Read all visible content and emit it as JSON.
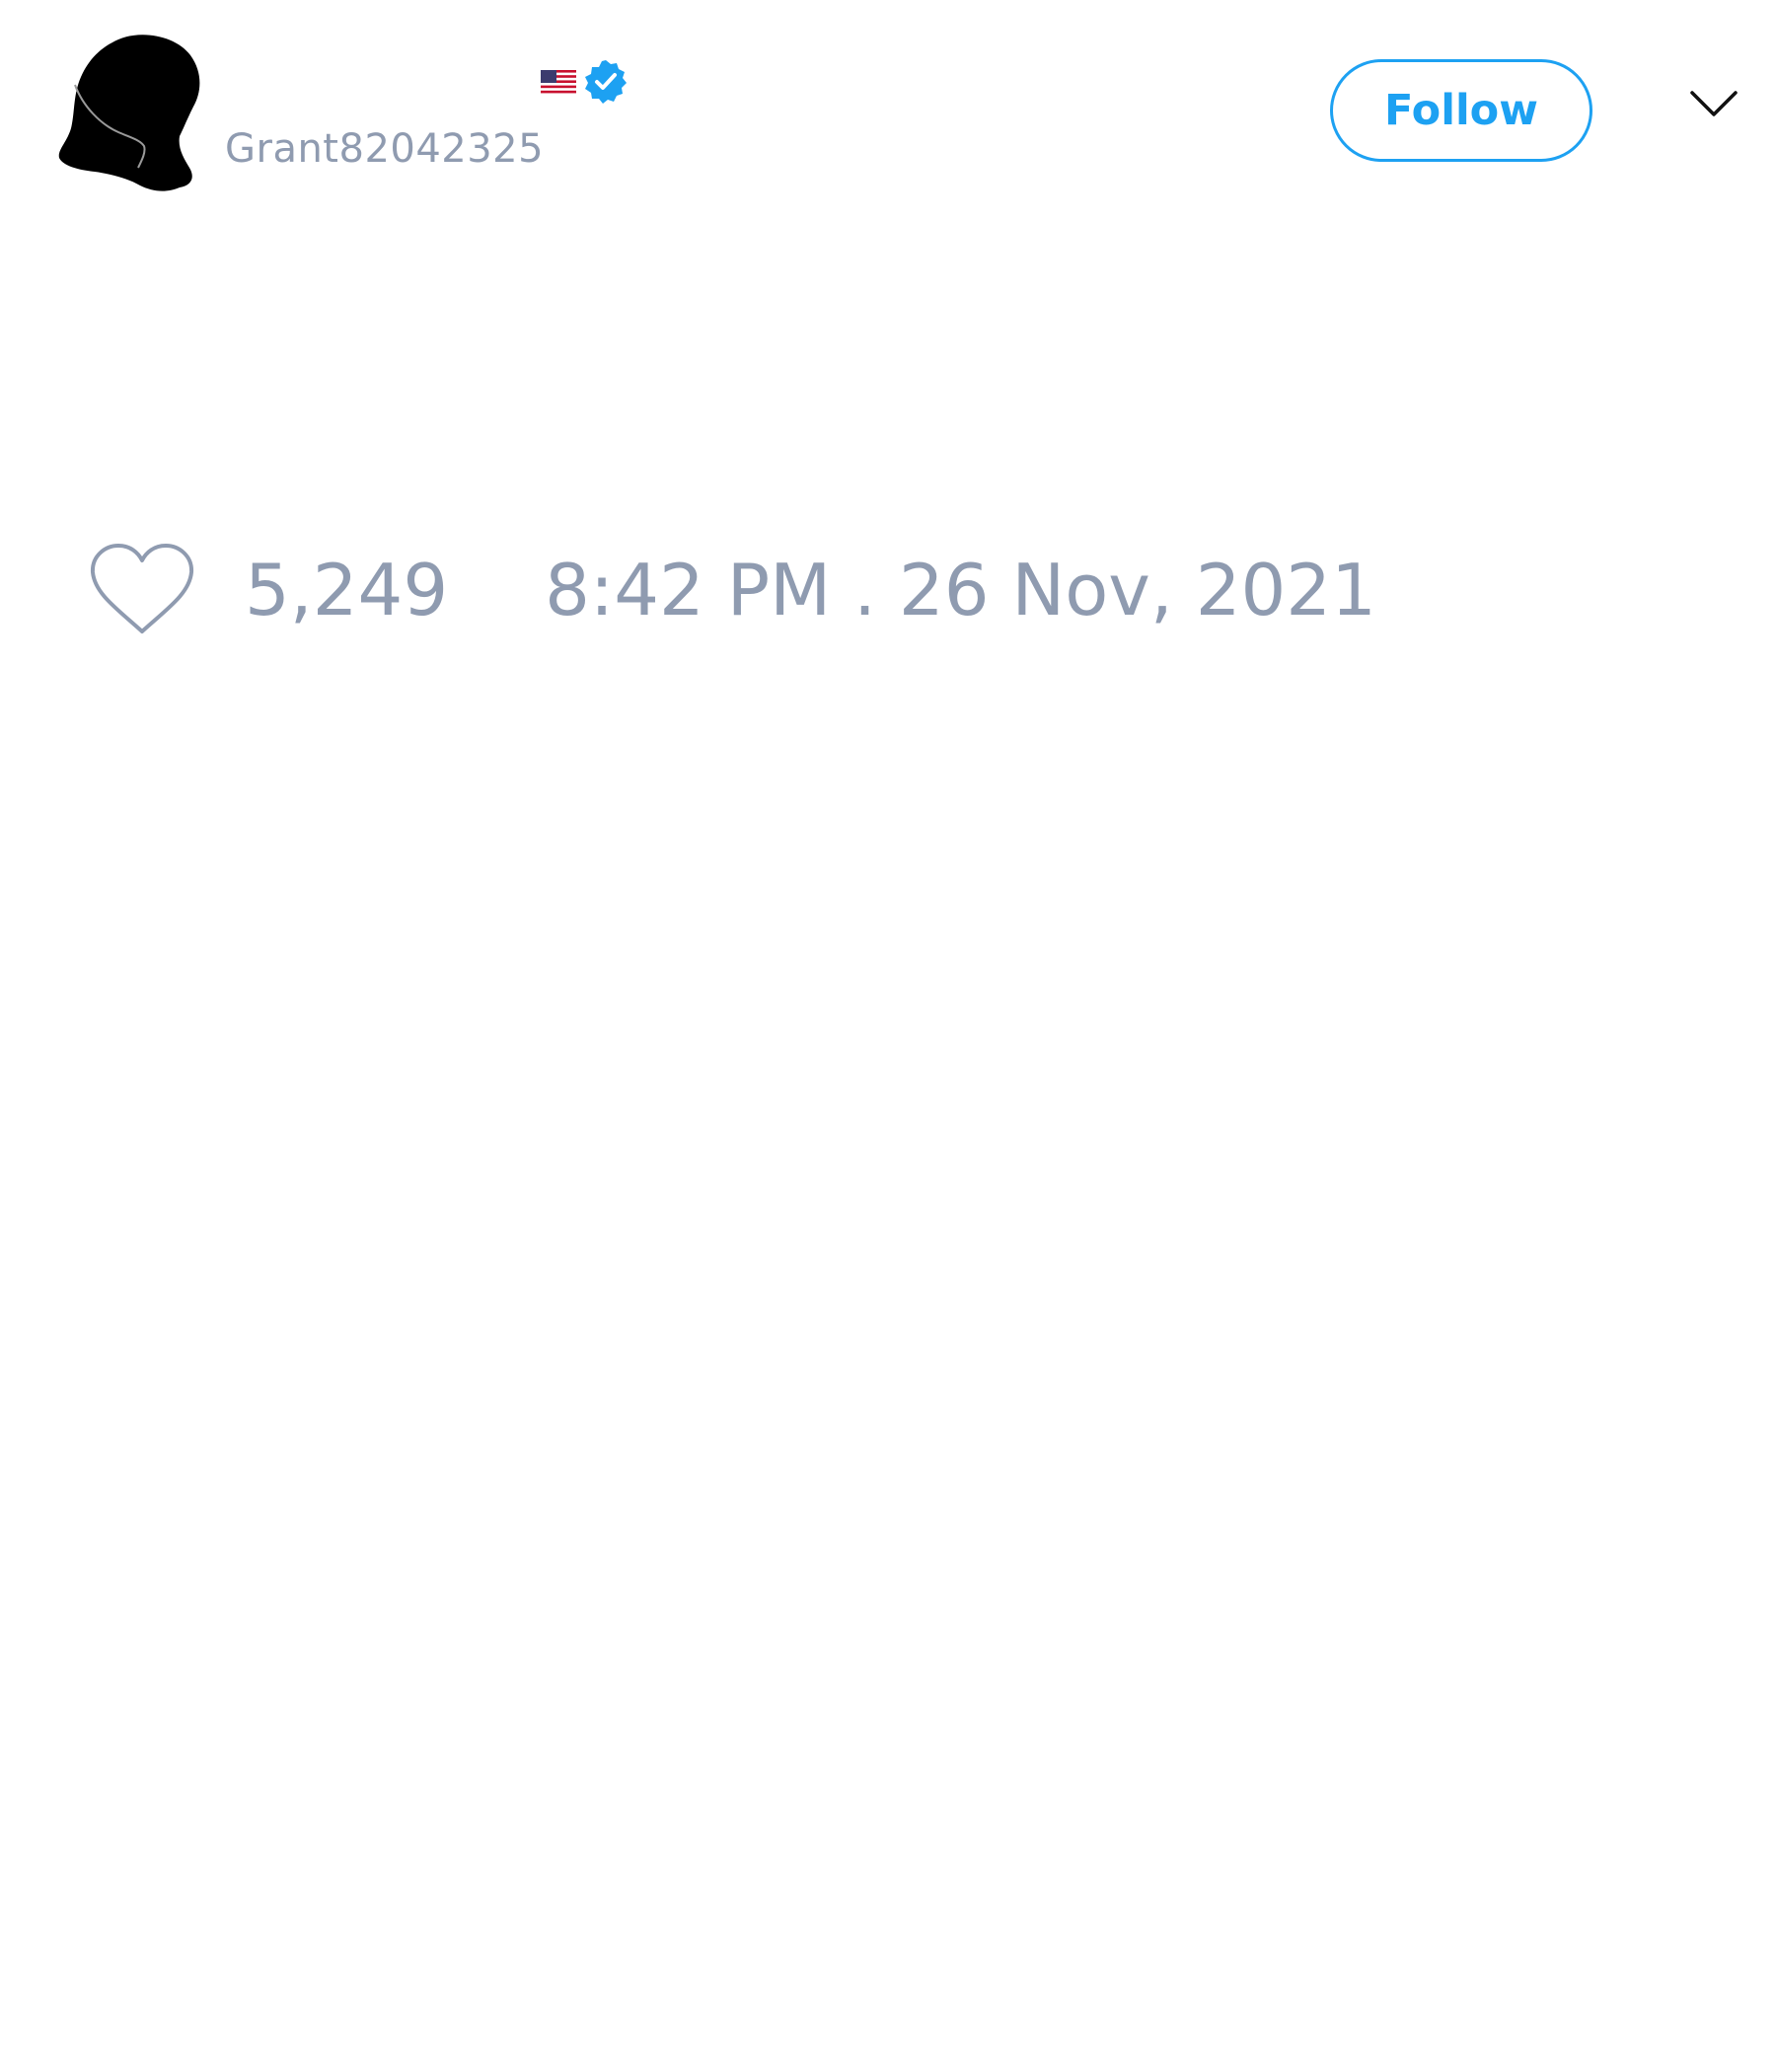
{
  "user": {
    "handle": "Grant82042325",
    "flag_icon": "us-flag-icon",
    "verified_icon": "verified-badge-icon",
    "verified_color": "#1da1f2"
  },
  "actions": {
    "follow_label": "Follow",
    "menu_icon": "chevron-down-icon",
    "accent_color": "#1da1f2"
  },
  "stats": {
    "like_icon": "heart-icon",
    "like_count": "5,249",
    "timestamp": "8:42 PM . 26 Nov, 2021",
    "meta_color": "#8f9bb0"
  }
}
